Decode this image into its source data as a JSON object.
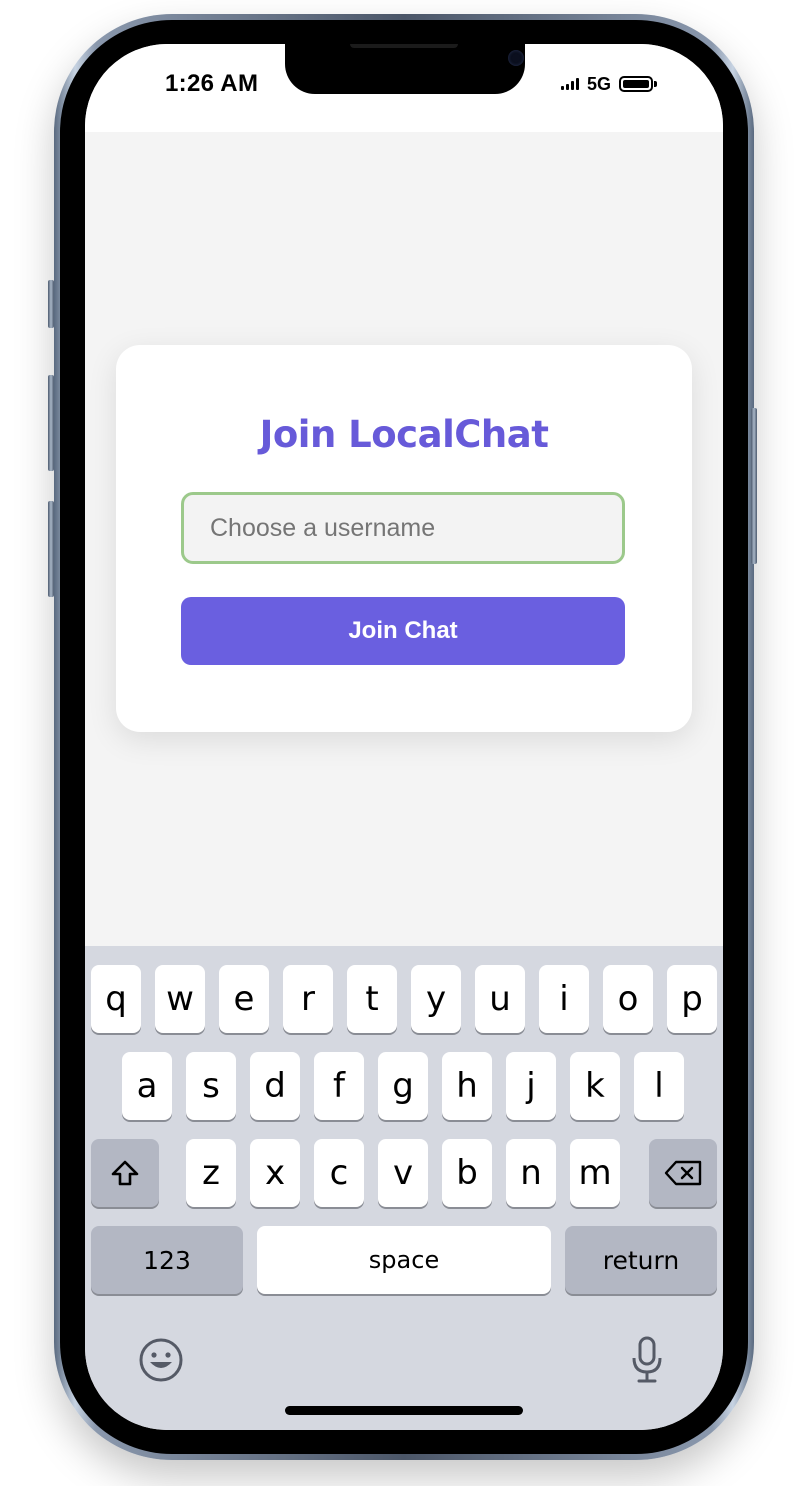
{
  "status_bar": {
    "time": "1:26 AM",
    "network": "5G"
  },
  "login_card": {
    "title": "Join LocalChat",
    "username_placeholder": "Choose a username",
    "username_value": "",
    "join_button_label": "Join Chat"
  },
  "keyboard": {
    "row1": [
      "q",
      "w",
      "e",
      "r",
      "t",
      "y",
      "u",
      "i",
      "o",
      "p"
    ],
    "row2": [
      "a",
      "s",
      "d",
      "f",
      "g",
      "h",
      "j",
      "k",
      "l"
    ],
    "row3": [
      "z",
      "x",
      "c",
      "v",
      "b",
      "n",
      "m"
    ],
    "numbers_key": "123",
    "space_key": "space",
    "return_key": "return",
    "icons": {
      "shift": "shift-arrow-icon",
      "delete": "backspace-icon",
      "emoji": "emoji-smiley-icon",
      "dictation": "microphone-icon"
    }
  },
  "colors": {
    "accent": "#675ad9",
    "button": "#6a5fe0",
    "input_border": "#9cc98b",
    "screen_background": "#f4f4f4",
    "keyboard_background": "#d5d8e0"
  }
}
